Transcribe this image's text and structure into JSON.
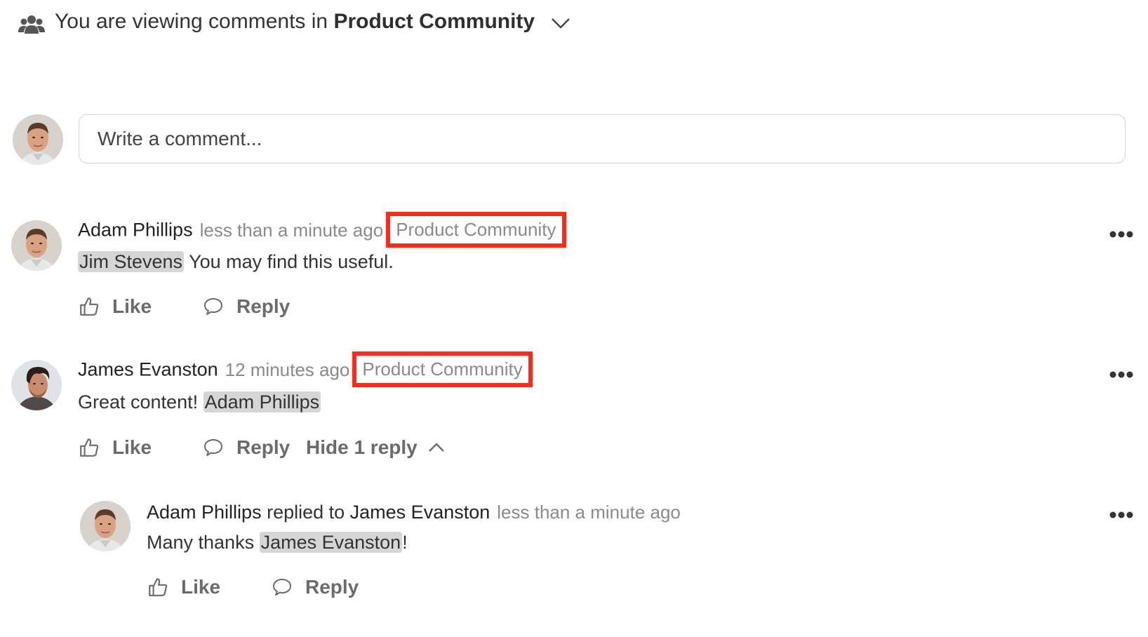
{
  "header": {
    "prefix": "You are viewing comments in",
    "community": "Product Community"
  },
  "composer": {
    "placeholder": "Write a comment..."
  },
  "comments": [
    {
      "author": "Adam Phillips",
      "time": "less than a minute ago",
      "community": "Product Community",
      "mention": "Jim Stevens",
      "text": " You may find this useful.",
      "like_label": "Like",
      "reply_label": "Reply"
    },
    {
      "author": "James Evanston",
      "time": "12 minutes ago",
      "community": "Product Community",
      "text": "Great content! ",
      "mention": "Adam Phillips",
      "like_label": "Like",
      "reply_label": "Reply",
      "toggle_label": "Hide 1 reply"
    }
  ],
  "reply": {
    "author": "Adam Phillips",
    "replied_to_label": " replied to ",
    "target": "James Evanston",
    "time": "less than a minute ago",
    "text": "Many thanks ",
    "mention": "James Evanston",
    "suffix": "!",
    "like_label": "Like",
    "reply_label": "Reply"
  },
  "colors": {
    "highlight_border": "#ff2a1a",
    "mention_bg": "#d6d6d6",
    "muted": "#8a8a8a"
  },
  "icons": [
    "users-icon",
    "chevron-down-icon",
    "more-options-icon",
    "thumbs-up-icon",
    "speech-bubble-icon",
    "chevron-up-icon"
  ]
}
